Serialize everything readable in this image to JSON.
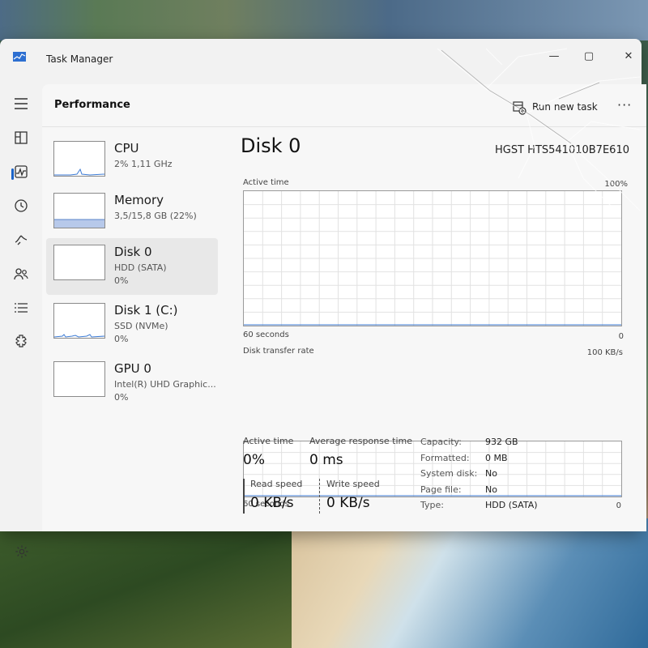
{
  "window": {
    "title": "Task Manager"
  },
  "nav": {
    "items": [
      {
        "icon": "hamburger-icon"
      },
      {
        "icon": "processes-icon"
      },
      {
        "icon": "performance-icon"
      },
      {
        "icon": "app-history-icon"
      },
      {
        "icon": "startup-apps-icon"
      },
      {
        "icon": "users-icon"
      },
      {
        "icon": "details-icon"
      },
      {
        "icon": "services-icon"
      }
    ],
    "settings_icon": "settings-icon"
  },
  "header": {
    "title": "Performance",
    "run_new_task": "Run new task",
    "more": "···"
  },
  "devices": [
    {
      "name": "CPU",
      "sub": "2%  1,11 GHz",
      "pct": "",
      "selected": false
    },
    {
      "name": "Memory",
      "sub": "3,5/15,8 GB (22%)",
      "pct": "",
      "selected": false
    },
    {
      "name": "Disk 0",
      "sub": "HDD (SATA)",
      "pct": "0%",
      "selected": true
    },
    {
      "name": "Disk 1 (C:)",
      "sub": "SSD (NVMe)",
      "pct": "0%",
      "selected": false
    },
    {
      "name": "GPU 0",
      "sub": "Intel(R) UHD Graphic...",
      "pct": "0%",
      "selected": false
    }
  ],
  "detail": {
    "title": "Disk 0",
    "model": "HGST HTS541010B7E610",
    "active_time_graph": {
      "label": "Active time",
      "max": "100%",
      "time": "60 seconds",
      "min": "0"
    },
    "transfer_graph": {
      "label": "Disk transfer rate",
      "max": "100 KB/s",
      "time": "60 seconds",
      "min": "0"
    },
    "stats": {
      "active_time_label": "Active time",
      "active_time_value": "0%",
      "avg_response_label": "Average response time",
      "avg_response_value": "0 ms",
      "read_label": "Read speed",
      "read_value": "0 KB/s",
      "write_label": "Write speed",
      "write_value": "0 KB/s"
    },
    "properties": [
      {
        "label": "Capacity:",
        "value": "932 GB"
      },
      {
        "label": "Formatted:",
        "value": "0 MB"
      },
      {
        "label": "System disk:",
        "value": "No"
      },
      {
        "label": "Page file:",
        "value": "No"
      },
      {
        "label": "Type:",
        "value": "HDD (SATA)"
      }
    ]
  },
  "colors": {
    "accent": "#1a63c8",
    "memory_fill": "#b7c9ea",
    "graph_line": "#3d7bd4"
  }
}
